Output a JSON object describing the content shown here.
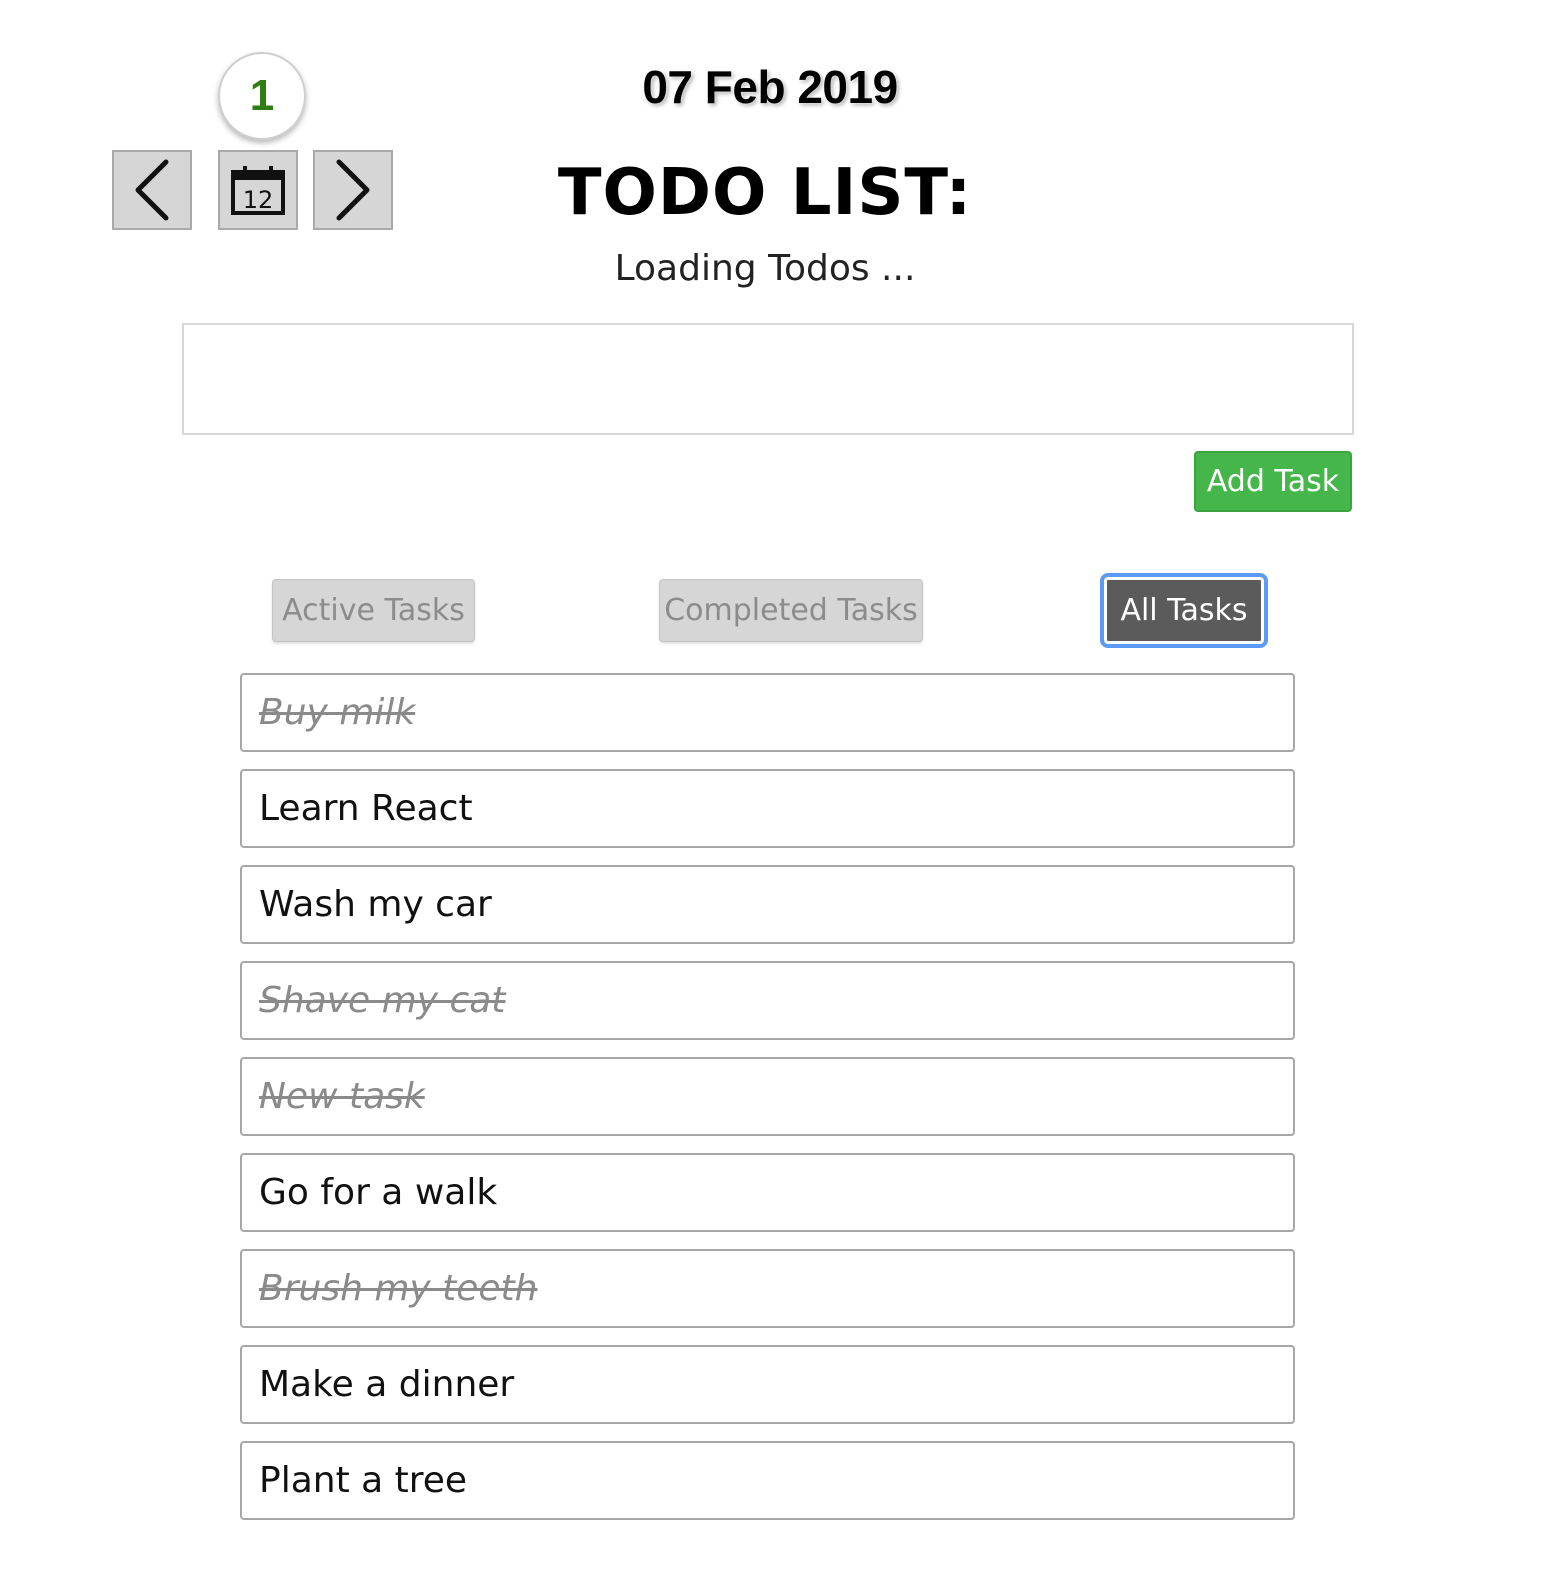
{
  "badge": {
    "count": "1"
  },
  "nav": {
    "prev_icon": "chevron-left-icon",
    "calendar_icon": "calendar-icon",
    "calendar_day": "12",
    "next_icon": "chevron-right-icon"
  },
  "header": {
    "date": "07 Feb 2019",
    "title": "TODO LIST:",
    "status": "Loading Todos ..."
  },
  "input": {
    "value": "",
    "placeholder": ""
  },
  "add_button": {
    "label": "Add Task"
  },
  "filters": [
    {
      "label": "Active Tasks",
      "selected": false
    },
    {
      "label": "Completed Tasks",
      "selected": false
    },
    {
      "label": "All Tasks",
      "selected": true
    }
  ],
  "tasks": [
    {
      "text": "Buy milk",
      "completed": true
    },
    {
      "text": "Learn React",
      "completed": false
    },
    {
      "text": "Wash my car",
      "completed": false
    },
    {
      "text": "Shave my cat",
      "completed": true
    },
    {
      "text": "New task",
      "completed": true
    },
    {
      "text": "Go for a walk",
      "completed": false
    },
    {
      "text": "Brush my teeth",
      "completed": true
    },
    {
      "text": "Make a dinner",
      "completed": false
    },
    {
      "text": "Plant a tree",
      "completed": false
    }
  ],
  "colors": {
    "accent_green": "#45b649",
    "badge_text": "#2f7d14",
    "active_filter_bg": "#5b5b5b",
    "focus_ring": "#5b9bf5"
  }
}
